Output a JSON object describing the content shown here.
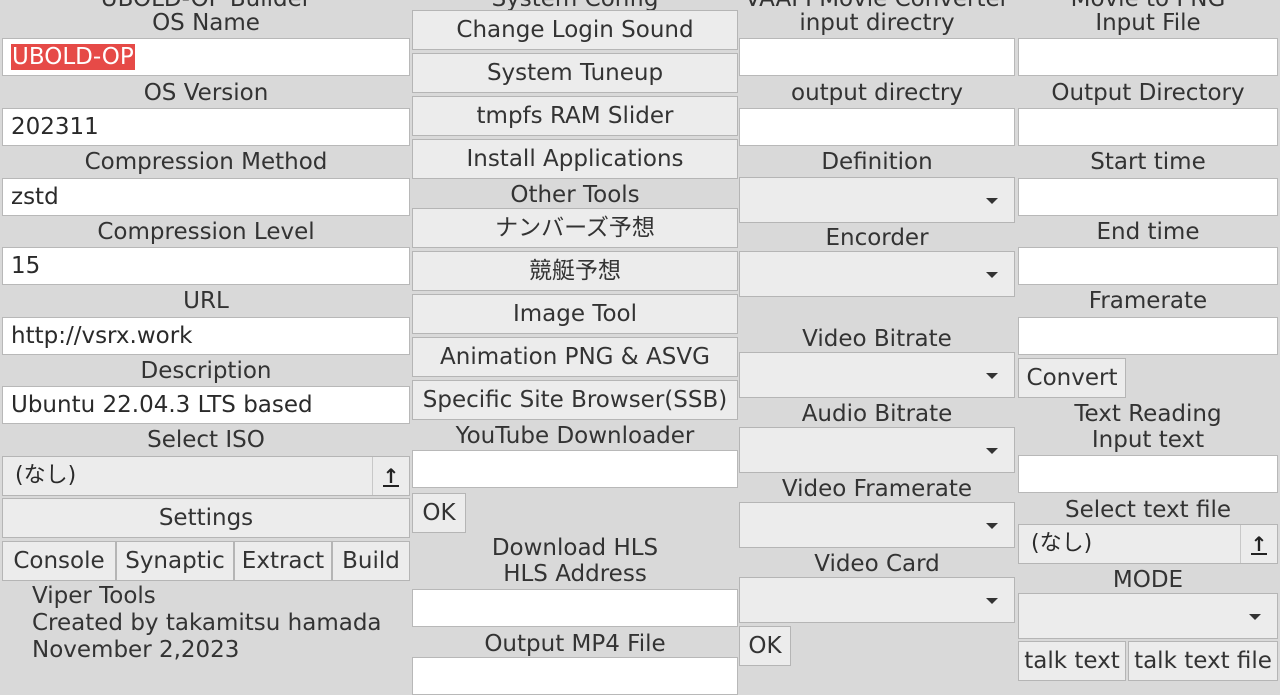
{
  "col1": {
    "header": "UBOLD-OP Builder",
    "os_name_label": "OS Name",
    "os_name_value": "UBOLD-OP",
    "os_version_label": "OS Version",
    "os_version_value": "202311",
    "compression_method_label": "Compression Method",
    "compression_method_value": "zstd",
    "compression_level_label": "Compression Level",
    "compression_level_value": "15",
    "url_label": "URL",
    "url_value": "http://vsrx.work",
    "description_label": "Description",
    "description_value": "Ubuntu 22.04.3 LTS based",
    "select_iso_label": "Select ISO",
    "select_iso_value": "(なし)",
    "settings_button": "Settings",
    "console_button": "Console",
    "synaptic_button": "Synaptic",
    "extract_button": "Extract",
    "build_button": "Build",
    "info_line1": "Viper Tools",
    "info_line2": "Created by takamitsu hamada",
    "info_line3": "November 2,2023"
  },
  "col2": {
    "header": "System Config",
    "change_login_sound": "Change Login Sound",
    "system_tuneup": "System Tuneup",
    "tmpfs_ram_slider": "tmpfs RAM Slider",
    "install_applications": "Install Applications",
    "other_tools_label": "Other Tools",
    "numbers_prediction": "ナンバーズ予想",
    "boat_race_prediction": "競艇予想",
    "image_tool": "Image Tool",
    "animation_png": "Animation PNG & ASVG",
    "ssb": "Specific Site Browser(SSB)",
    "youtube_label": "YouTube Downloader",
    "youtube_value": "",
    "ok_button": "OK",
    "hls_label1": "Download HLS",
    "hls_label2": "HLS Address",
    "hls_value": "",
    "output_mp4_label": "Output MP4 File",
    "output_mp4_value": ""
  },
  "col3": {
    "header": "VAAPI Movie Converter",
    "input_dir_label": "input directry",
    "output_dir_label": "output directry",
    "definition_label": "Definition",
    "encoder_label": "Encorder",
    "video_bitrate_label": "Video Bitrate",
    "audio_bitrate_label": "Audio Bitrate",
    "video_framerate_label": "Video Framerate",
    "video_card_label": "Video Card",
    "ok_button": "OK"
  },
  "col4": {
    "header": "Movie to PNG",
    "input_file_label": "Input File",
    "output_dir_label": "Output Directory",
    "start_time_label": "Start time",
    "end_time_label": "End time",
    "framerate_label": "Framerate",
    "convert_button": "Convert",
    "text_reading_label": "Text Reading",
    "input_text_label": "Input text",
    "select_text_file_label": "Select text file",
    "select_text_file_value": "(なし)",
    "mode_label": "MODE",
    "talk_text_button": "talk text",
    "talk_text_file_button": "talk text file"
  }
}
